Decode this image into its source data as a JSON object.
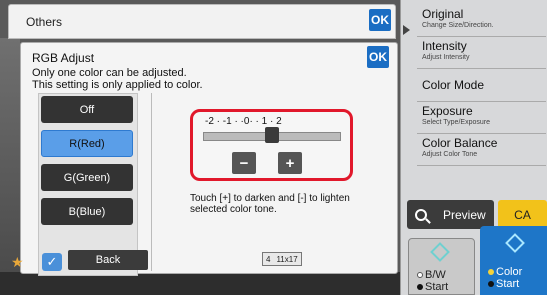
{
  "dialog": {
    "title": "Others",
    "ok_label": "OK"
  },
  "panel": {
    "title": "RGB Adjust",
    "ok_label": "OK",
    "description_line1": "Only one color can be adjusted.",
    "description_line2": "This setting is only applied to color.",
    "buttons": [
      {
        "label": "Off",
        "active": false
      },
      {
        "label": "R(Red)",
        "active": true
      },
      {
        "label": "G(Green)",
        "active": false
      },
      {
        "label": "B(Blue)",
        "active": false
      }
    ],
    "slider": {
      "scale": "-2 · -1 · ·0· · 1 · 2",
      "value": 0,
      "min": -2,
      "max": 2,
      "minus_label": "−",
      "plus_label": "+"
    },
    "help_line1": "Touch [+] to darken and [-] to lighten",
    "help_line2": "selected color tone."
  },
  "right_panel": {
    "items": [
      {
        "label": "Original",
        "sub": "Change Size/Direction."
      },
      {
        "label": "Intensity",
        "sub": "Adjust Intensity"
      },
      {
        "label": "Color Mode",
        "sub": ""
      },
      {
        "label": "Exposure",
        "sub": "Select Type/Exposure"
      },
      {
        "label": "Color Balance",
        "sub": "Adjust Color Tone"
      }
    ],
    "preview_label": "Preview",
    "ca_label": "CA",
    "bw_start_line1": "B/W",
    "bw_start_line2": "Start",
    "color_start_line1": "Color",
    "color_start_line2": "Start"
  },
  "footer": {
    "back_label": "Back",
    "paper_count": "4",
    "paper_size": "11x17"
  },
  "colors": {
    "accent_blue": "#1a6dc3",
    "highlight_red": "#e1182b",
    "ca_yellow": "#f2c21a"
  }
}
